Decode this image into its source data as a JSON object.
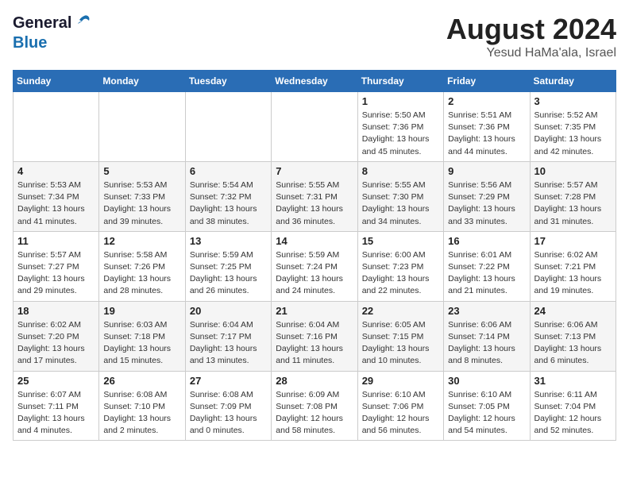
{
  "header": {
    "logo_general": "General",
    "logo_blue": "Blue",
    "main_title": "August 2024",
    "sub_title": "Yesud HaMa'ala, Israel"
  },
  "days_of_week": [
    "Sunday",
    "Monday",
    "Tuesday",
    "Wednesday",
    "Thursday",
    "Friday",
    "Saturday"
  ],
  "weeks": [
    {
      "days": [
        {
          "num": "",
          "info": ""
        },
        {
          "num": "",
          "info": ""
        },
        {
          "num": "",
          "info": ""
        },
        {
          "num": "",
          "info": ""
        },
        {
          "num": "1",
          "info": "Sunrise: 5:50 AM\nSunset: 7:36 PM\nDaylight: 13 hours\nand 45 minutes."
        },
        {
          "num": "2",
          "info": "Sunrise: 5:51 AM\nSunset: 7:36 PM\nDaylight: 13 hours\nand 44 minutes."
        },
        {
          "num": "3",
          "info": "Sunrise: 5:52 AM\nSunset: 7:35 PM\nDaylight: 13 hours\nand 42 minutes."
        }
      ]
    },
    {
      "days": [
        {
          "num": "4",
          "info": "Sunrise: 5:53 AM\nSunset: 7:34 PM\nDaylight: 13 hours\nand 41 minutes."
        },
        {
          "num": "5",
          "info": "Sunrise: 5:53 AM\nSunset: 7:33 PM\nDaylight: 13 hours\nand 39 minutes."
        },
        {
          "num": "6",
          "info": "Sunrise: 5:54 AM\nSunset: 7:32 PM\nDaylight: 13 hours\nand 38 minutes."
        },
        {
          "num": "7",
          "info": "Sunrise: 5:55 AM\nSunset: 7:31 PM\nDaylight: 13 hours\nand 36 minutes."
        },
        {
          "num": "8",
          "info": "Sunrise: 5:55 AM\nSunset: 7:30 PM\nDaylight: 13 hours\nand 34 minutes."
        },
        {
          "num": "9",
          "info": "Sunrise: 5:56 AM\nSunset: 7:29 PM\nDaylight: 13 hours\nand 33 minutes."
        },
        {
          "num": "10",
          "info": "Sunrise: 5:57 AM\nSunset: 7:28 PM\nDaylight: 13 hours\nand 31 minutes."
        }
      ]
    },
    {
      "days": [
        {
          "num": "11",
          "info": "Sunrise: 5:57 AM\nSunset: 7:27 PM\nDaylight: 13 hours\nand 29 minutes."
        },
        {
          "num": "12",
          "info": "Sunrise: 5:58 AM\nSunset: 7:26 PM\nDaylight: 13 hours\nand 28 minutes."
        },
        {
          "num": "13",
          "info": "Sunrise: 5:59 AM\nSunset: 7:25 PM\nDaylight: 13 hours\nand 26 minutes."
        },
        {
          "num": "14",
          "info": "Sunrise: 5:59 AM\nSunset: 7:24 PM\nDaylight: 13 hours\nand 24 minutes."
        },
        {
          "num": "15",
          "info": "Sunrise: 6:00 AM\nSunset: 7:23 PM\nDaylight: 13 hours\nand 22 minutes."
        },
        {
          "num": "16",
          "info": "Sunrise: 6:01 AM\nSunset: 7:22 PM\nDaylight: 13 hours\nand 21 minutes."
        },
        {
          "num": "17",
          "info": "Sunrise: 6:02 AM\nSunset: 7:21 PM\nDaylight: 13 hours\nand 19 minutes."
        }
      ]
    },
    {
      "days": [
        {
          "num": "18",
          "info": "Sunrise: 6:02 AM\nSunset: 7:20 PM\nDaylight: 13 hours\nand 17 minutes."
        },
        {
          "num": "19",
          "info": "Sunrise: 6:03 AM\nSunset: 7:18 PM\nDaylight: 13 hours\nand 15 minutes."
        },
        {
          "num": "20",
          "info": "Sunrise: 6:04 AM\nSunset: 7:17 PM\nDaylight: 13 hours\nand 13 minutes."
        },
        {
          "num": "21",
          "info": "Sunrise: 6:04 AM\nSunset: 7:16 PM\nDaylight: 13 hours\nand 11 minutes."
        },
        {
          "num": "22",
          "info": "Sunrise: 6:05 AM\nSunset: 7:15 PM\nDaylight: 13 hours\nand 10 minutes."
        },
        {
          "num": "23",
          "info": "Sunrise: 6:06 AM\nSunset: 7:14 PM\nDaylight: 13 hours\nand 8 minutes."
        },
        {
          "num": "24",
          "info": "Sunrise: 6:06 AM\nSunset: 7:13 PM\nDaylight: 13 hours\nand 6 minutes."
        }
      ]
    },
    {
      "days": [
        {
          "num": "25",
          "info": "Sunrise: 6:07 AM\nSunset: 7:11 PM\nDaylight: 13 hours\nand 4 minutes."
        },
        {
          "num": "26",
          "info": "Sunrise: 6:08 AM\nSunset: 7:10 PM\nDaylight: 13 hours\nand 2 minutes."
        },
        {
          "num": "27",
          "info": "Sunrise: 6:08 AM\nSunset: 7:09 PM\nDaylight: 13 hours\nand 0 minutes."
        },
        {
          "num": "28",
          "info": "Sunrise: 6:09 AM\nSunset: 7:08 PM\nDaylight: 12 hours\nand 58 minutes."
        },
        {
          "num": "29",
          "info": "Sunrise: 6:10 AM\nSunset: 7:06 PM\nDaylight: 12 hours\nand 56 minutes."
        },
        {
          "num": "30",
          "info": "Sunrise: 6:10 AM\nSunset: 7:05 PM\nDaylight: 12 hours\nand 54 minutes."
        },
        {
          "num": "31",
          "info": "Sunrise: 6:11 AM\nSunset: 7:04 PM\nDaylight: 12 hours\nand 52 minutes."
        }
      ]
    }
  ]
}
